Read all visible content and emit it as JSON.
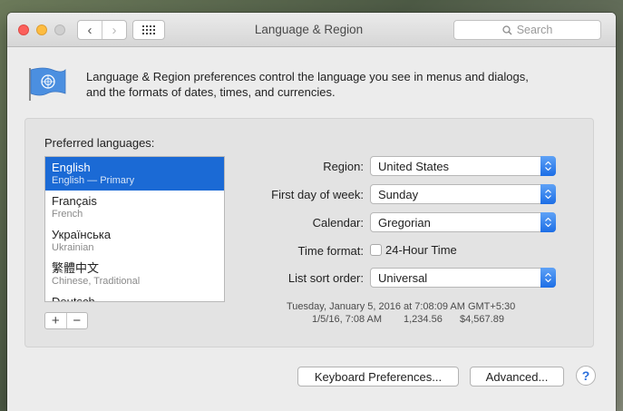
{
  "window": {
    "title": "Language & Region"
  },
  "toolbar": {
    "search_placeholder": "Search",
    "back_glyph": "‹",
    "forward_glyph": "›"
  },
  "description": {
    "line1": "Language & Region preferences control the language you see in menus and dialogs,",
    "line2": "and the formats of dates, times, and currencies."
  },
  "preferred_languages": {
    "label": "Preferred languages:",
    "items": [
      {
        "name": "English",
        "sub": "English — Primary",
        "selected": true
      },
      {
        "name": "Français",
        "sub": "French",
        "selected": false
      },
      {
        "name": "Українська",
        "sub": "Ukrainian",
        "selected": false
      },
      {
        "name": "繁體中文",
        "sub": "Chinese, Traditional",
        "selected": false
      },
      {
        "name": "Deutsch",
        "sub": "",
        "selected": false
      }
    ],
    "add_label": "+",
    "remove_label": "−"
  },
  "settings": {
    "region": {
      "label": "Region:",
      "value": "United States"
    },
    "first_day": {
      "label": "First day of week:",
      "value": "Sunday"
    },
    "calendar": {
      "label": "Calendar:",
      "value": "Gregorian"
    },
    "time_format": {
      "label": "Time format:",
      "option": "24-Hour Time",
      "checked": false
    },
    "sort_order": {
      "label": "List sort order:",
      "value": "Universal"
    }
  },
  "sample": {
    "line1": "Tuesday, January 5, 2016 at 7:08:09 AM GMT+5:30",
    "date_short": "1/5/16, 7:08 AM",
    "number": "1,234.56",
    "currency": "$4,567.89"
  },
  "buttons": {
    "keyboard": "Keyboard Preferences...",
    "advanced": "Advanced...",
    "help": "?"
  },
  "colors": {
    "selection": "#1b6ad5",
    "popup_arrows": "#1c6ee6",
    "close": "#fc605c",
    "minimize": "#fdbc40"
  },
  "icons": {
    "flag": "un-flag-icon",
    "search": "search-icon"
  }
}
